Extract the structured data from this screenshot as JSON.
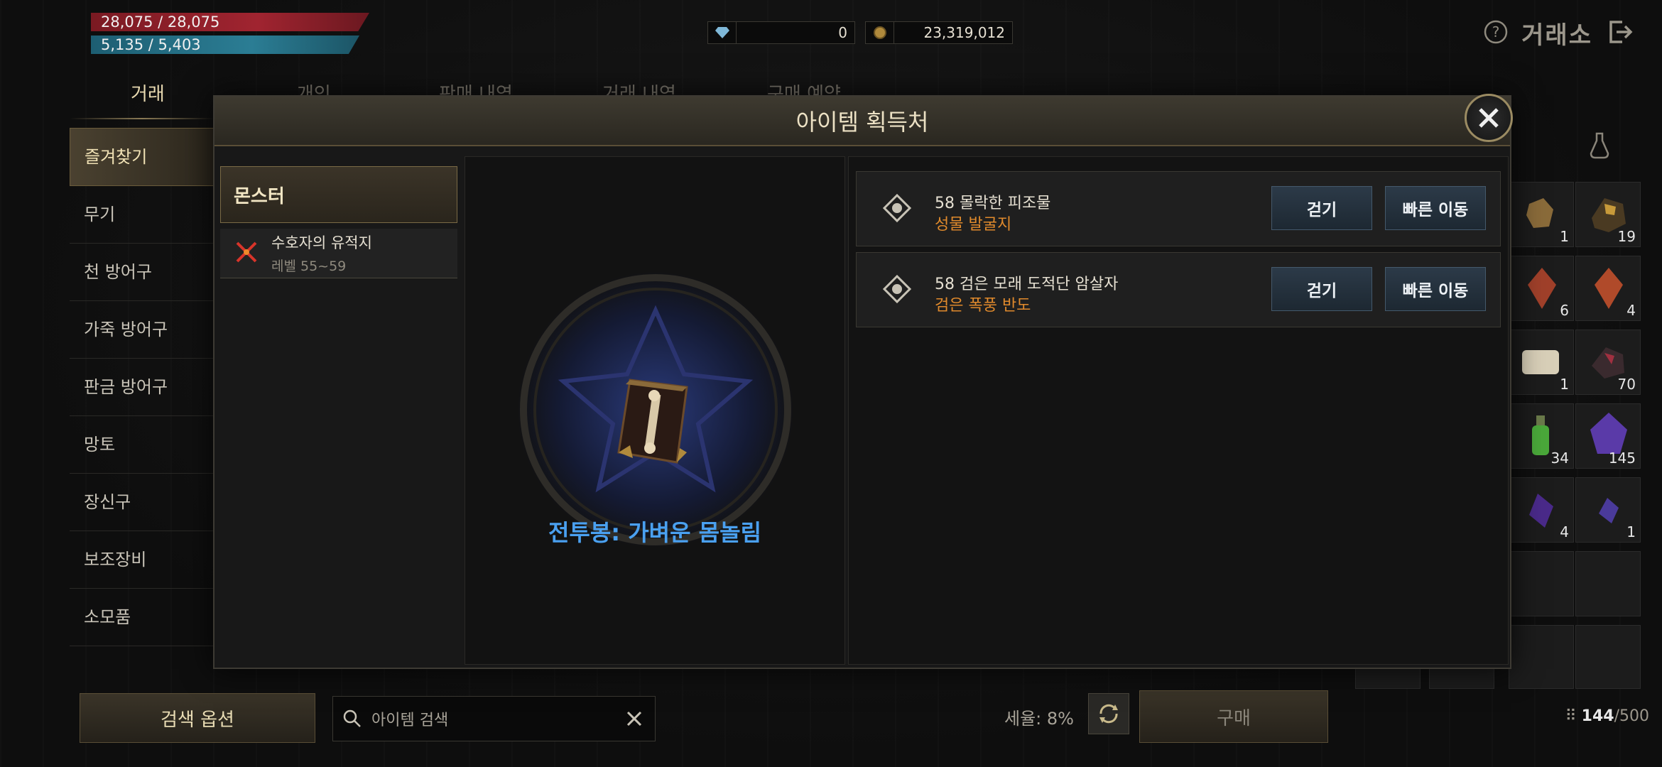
{
  "status": {
    "hp": "28,075 / 28,075",
    "mp": "5,135 / 5,403"
  },
  "currency": {
    "diamond": "0",
    "gold": "23,319,012"
  },
  "header": {
    "title": "거래소"
  },
  "tabs": [
    "거래",
    "개인",
    "판매 내역",
    "거래 내역",
    "구매 예약"
  ],
  "categories": [
    "즐겨찾기",
    "무기",
    "천 방어구",
    "가죽 방어구",
    "판금 방어구",
    "망토",
    "장신구",
    "보조장비",
    "소모품"
  ],
  "inventory": [
    {
      "icon": "rock-icon",
      "count": "1"
    },
    {
      "icon": "ore-icon",
      "count": "19"
    },
    {
      "icon": "red-crystal-icon",
      "count": "6"
    },
    {
      "icon": "red-crystal-icon",
      "count": "4"
    },
    {
      "icon": "scroll-icon",
      "count": "1"
    },
    {
      "icon": "dark-ore-icon",
      "count": "70"
    },
    {
      "icon": "green-potion-icon",
      "count": "34"
    },
    {
      "icon": "purple-gem-icon",
      "count": "145"
    },
    {
      "icon": "purple-shard-icon",
      "count": "4"
    },
    {
      "icon": "purple-shard-icon",
      "count": "1"
    }
  ],
  "bottom": {
    "search_option": "검색 옵션",
    "search_placeholder": "아이템 검색",
    "tax": "세율: 8%",
    "buy": "구매",
    "capacity_used": "144",
    "capacity_total": "/500"
  },
  "modal": {
    "title": "아이템 획득처",
    "source_header": "몬스터",
    "source": {
      "name": "수호자의 유적지",
      "level": "레벨 55~59"
    },
    "item_name": "전투봉: 가벼운 몸놀림",
    "entries": [
      {
        "monster": "58 몰락한 피조물",
        "location": "성물 발굴지",
        "walk": "걷기",
        "fast": "빠른 이동"
      },
      {
        "monster": "58 검은 모래 도적단 암살자",
        "location": "검은 폭풍 반도",
        "walk": "걷기",
        "fast": "빠른 이동"
      }
    ]
  }
}
